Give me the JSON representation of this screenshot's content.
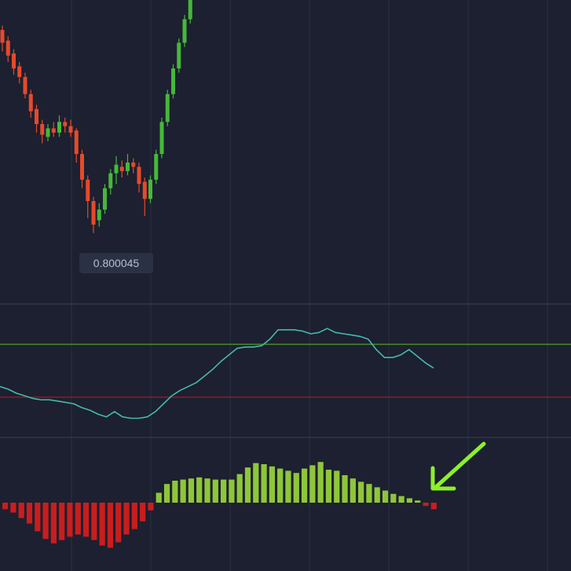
{
  "colors": {
    "background": "#1c2030",
    "bull": "#46b83a",
    "bear": "#e54a2b",
    "oscillator_line": "#46b8b0",
    "upper_level": "#4a8a2a",
    "lower_level": "#8a1e22",
    "histogram_pos": "#8ec63a",
    "histogram_neg": "#c81e1e",
    "arrow": "#8cf028"
  },
  "chart_data": [
    {
      "type": "candlestick",
      "label": "0.800045",
      "candles": [
        {
          "o": 98,
          "c": 92,
          "h": 100,
          "l": 88
        },
        {
          "o": 93,
          "c": 86,
          "h": 95,
          "l": 83
        },
        {
          "o": 87,
          "c": 80,
          "h": 89,
          "l": 77
        },
        {
          "o": 81,
          "c": 76,
          "h": 83,
          "l": 73
        },
        {
          "o": 76,
          "c": 68,
          "h": 78,
          "l": 66
        },
        {
          "o": 68,
          "c": 60,
          "h": 70,
          "l": 57
        },
        {
          "o": 61,
          "c": 54,
          "h": 63,
          "l": 50
        },
        {
          "o": 54,
          "c": 49,
          "h": 56,
          "l": 45
        },
        {
          "o": 48,
          "c": 52,
          "h": 54,
          "l": 46
        },
        {
          "o": 52,
          "c": 50,
          "h": 55,
          "l": 48
        },
        {
          "o": 50,
          "c": 55,
          "h": 58,
          "l": 48
        },
        {
          "o": 55,
          "c": 53,
          "h": 57,
          "l": 50
        },
        {
          "o": 53,
          "c": 50,
          "h": 56,
          "l": 48
        },
        {
          "o": 51,
          "c": 40,
          "h": 52,
          "l": 36
        },
        {
          "o": 40,
          "c": 28,
          "h": 42,
          "l": 24
        },
        {
          "o": 28,
          "c": 18,
          "h": 30,
          "l": 10
        },
        {
          "o": 18,
          "c": 7,
          "h": 20,
          "l": 3
        },
        {
          "o": 9,
          "c": 14,
          "h": 17,
          "l": 6
        },
        {
          "o": 14,
          "c": 24,
          "h": 26,
          "l": 12
        },
        {
          "o": 24,
          "c": 31,
          "h": 33,
          "l": 21
        },
        {
          "o": 31,
          "c": 35,
          "h": 39,
          "l": 26
        },
        {
          "o": 34,
          "c": 32,
          "h": 37,
          "l": 29
        },
        {
          "o": 32,
          "c": 36,
          "h": 40,
          "l": 30
        },
        {
          "o": 36,
          "c": 34,
          "h": 38,
          "l": 31
        },
        {
          "o": 34,
          "c": 26,
          "h": 36,
          "l": 22
        },
        {
          "o": 27,
          "c": 19,
          "h": 29,
          "l": 11
        },
        {
          "o": 19,
          "c": 28,
          "h": 30,
          "l": 17
        },
        {
          "o": 28,
          "c": 40,
          "h": 42,
          "l": 26
        },
        {
          "o": 40,
          "c": 55,
          "h": 57,
          "l": 38
        },
        {
          "o": 55,
          "c": 68,
          "h": 70,
          "l": 53
        },
        {
          "o": 68,
          "c": 80,
          "h": 82,
          "l": 66
        },
        {
          "o": 80,
          "c": 92,
          "h": 94,
          "l": 78
        },
        {
          "o": 92,
          "c": 103,
          "h": 105,
          "l": 90
        },
        {
          "o": 103,
          "c": 112,
          "h": 114,
          "l": 101
        }
      ]
    },
    {
      "type": "line",
      "levels": {
        "upper": 70,
        "lower": 30
      },
      "values": [
        38,
        36,
        33,
        31,
        29,
        28,
        28,
        27,
        26,
        25,
        22,
        20,
        17,
        15,
        19,
        15,
        14,
        14,
        15,
        19,
        25,
        31,
        35,
        38,
        41,
        46,
        51,
        57,
        62,
        67,
        68,
        68,
        69,
        74,
        81,
        81,
        81,
        80,
        78,
        79,
        82,
        79,
        78,
        77,
        76,
        74,
        66,
        60,
        60,
        62,
        66,
        61,
        56,
        52
      ]
    },
    {
      "type": "bar",
      "values": [
        -0.6,
        -0.9,
        -1.4,
        -1.9,
        -2.6,
        -3.3,
        -3.7,
        -3.4,
        -3.1,
        -2.9,
        -3.1,
        -3.4,
        -3.9,
        -4.1,
        -3.6,
        -2.9,
        -2.4,
        -1.7,
        -0.7,
        0.9,
        1.7,
        2.0,
        2.1,
        2.2,
        2.3,
        2.2,
        2.1,
        2.1,
        2.1,
        2.6,
        3.2,
        3.6,
        3.5,
        3.3,
        3.1,
        2.9,
        2.7,
        3.1,
        3.4,
        3.7,
        3.0,
        2.9,
        2.5,
        2.2,
        1.9,
        1.7,
        1.4,
        1.1,
        0.8,
        0.6,
        0.4,
        0.2,
        -0.3,
        -0.6
      ]
    }
  ]
}
